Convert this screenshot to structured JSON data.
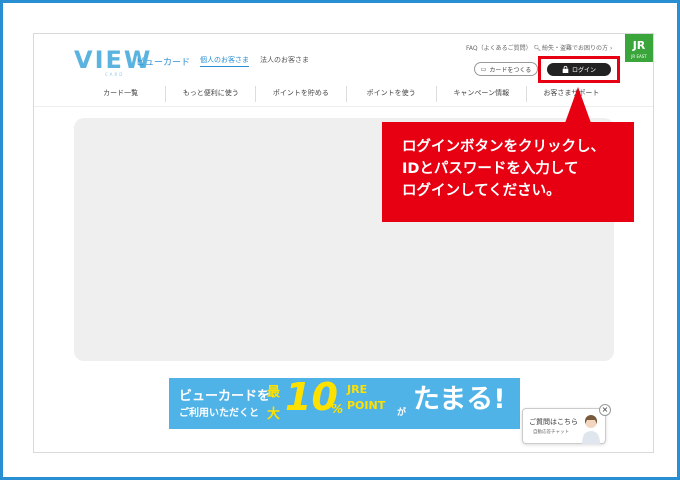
{
  "brand": {
    "logo": "VIEW",
    "logo_sub": "CARD",
    "name": "ビューカード"
  },
  "header": {
    "tab_personal": "個人のお客さま",
    "tab_corporate": "法人のお客さま",
    "faq": "FAQ（よくあるご質問）",
    "news": "紛失・盗難でお困りの方",
    "make_card_label": "カードをつくる",
    "login_label": "ログイン"
  },
  "jr_badge": {
    "label": "JR",
    "sub": "JR EAST"
  },
  "nav": {
    "items": [
      "カード一覧",
      "もっと便利に使う",
      "ポイントを貯める",
      "ポイントを使う",
      "キャンペーン情報",
      "お客さまサポート"
    ]
  },
  "banner": {
    "line1": "ビューカードを",
    "line2": "ご利用いただくと",
    "big1": "最",
    "big2": "大",
    "number": "10",
    "percent": "%",
    "jre": "JRE",
    "point": "POINT",
    "ga": "が",
    "tamaru": "たまる!"
  },
  "chat": {
    "line1": "ご質問はこちら",
    "line2": "自動応答チャット",
    "close": "×"
  },
  "callout": {
    "line1": "ログインボタンをクリックし、",
    "line2": "IDとパスワードを入力して",
    "line3": "ログインしてください。"
  },
  "colors": {
    "frame": "#2a8fd2",
    "accent_red": "#e60012",
    "brand_blue": "#5bb3df",
    "jr_green": "#3aa53a",
    "banner_blue": "#4fb3e8",
    "banner_yellow": "#ffe100"
  }
}
